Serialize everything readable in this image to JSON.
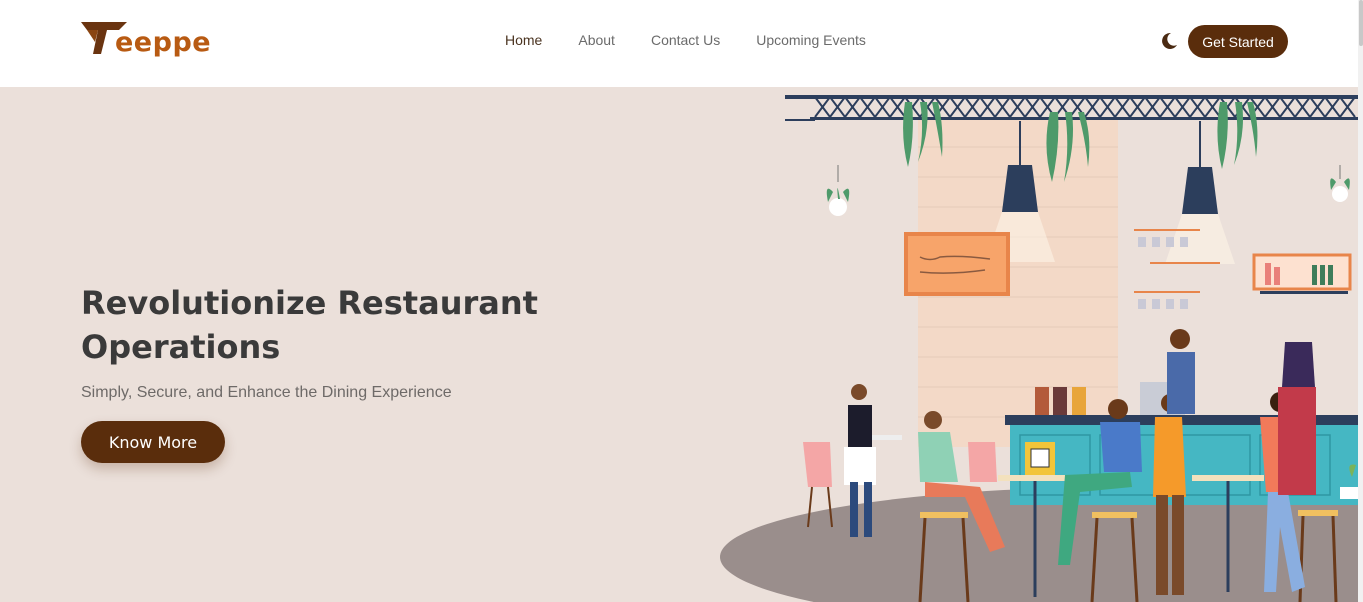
{
  "brand": {
    "logo_text": "eeppe"
  },
  "nav": {
    "items": [
      {
        "label": "Home",
        "active": true
      },
      {
        "label": "About",
        "active": false
      },
      {
        "label": "Contact Us",
        "active": false
      },
      {
        "label": "Upcoming Events",
        "active": false
      }
    ],
    "cta_label": "Get Started",
    "theme_icon": "moon-icon"
  },
  "hero": {
    "title": "Revolutionize Restaurant Operations",
    "subtitle": "Simply, Secure, and Enhance the Dining Experience",
    "button_label": "Know More"
  },
  "colors": {
    "brand_brown": "#5a2d0c",
    "logo_orange": "#b85a12",
    "hero_bg": "#ebe0da",
    "bar_teal": "#45b7c3"
  }
}
